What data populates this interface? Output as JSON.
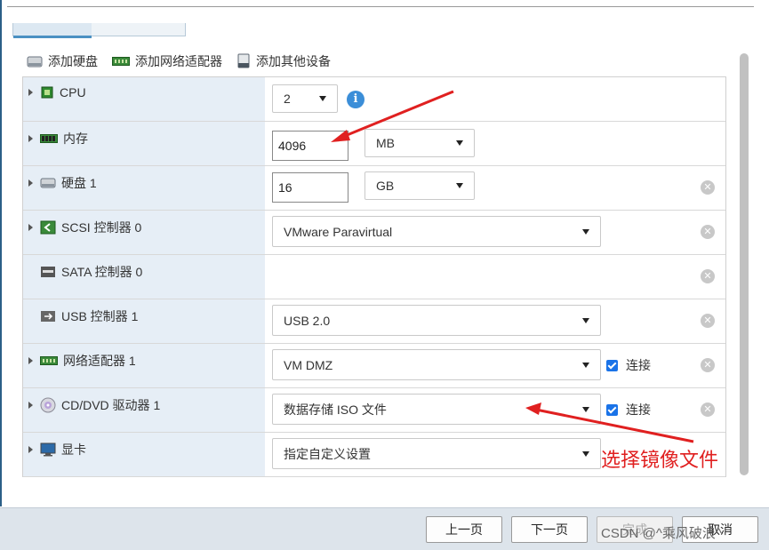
{
  "toolbar": {
    "add_disk": "添加硬盘",
    "add_network": "添加网络适配器",
    "add_other": "添加其他设备"
  },
  "rows": {
    "cpu": {
      "label": "CPU",
      "value": "2"
    },
    "memory": {
      "label": "内存",
      "value": "4096",
      "unit": "MB"
    },
    "disk": {
      "label": "硬盘 1",
      "value": "16",
      "unit": "GB"
    },
    "scsi": {
      "label": "SCSI 控制器 0",
      "value": "VMware Paravirtual"
    },
    "sata": {
      "label": "SATA 控制器 0"
    },
    "usb": {
      "label": "USB 控制器 1",
      "value": "USB 2.0"
    },
    "network": {
      "label": "网络适配器 1",
      "value": "VM DMZ",
      "connect": "连接"
    },
    "cddvd": {
      "label": "CD/DVD 驱动器 1",
      "value": "数据存储 ISO 文件",
      "connect": "连接"
    },
    "display": {
      "label": "显卡",
      "value": "指定自定义设置"
    }
  },
  "annotation": "选择镜像文件",
  "footer": {
    "prev": "上一页",
    "next": "下一页",
    "finish": "完成",
    "cancel": "取消"
  },
  "watermark": "CSDN @^乘风破浪^",
  "colors": {
    "accent": "#3b8ed8",
    "annotation": "#e02020",
    "label_bg": "#e6eef6"
  }
}
